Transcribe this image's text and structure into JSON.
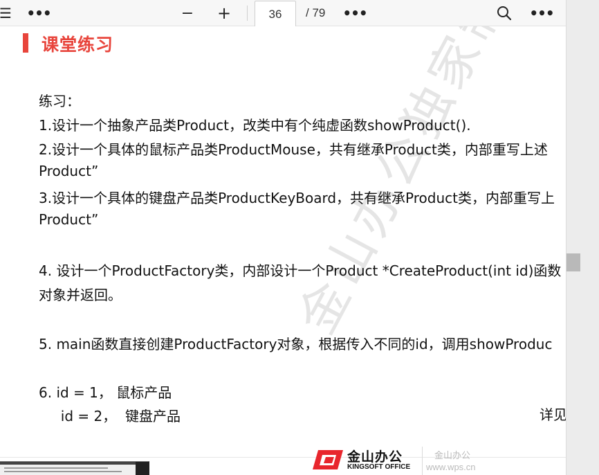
{
  "toolbar": {
    "menu_icon": "☰",
    "more_icon": "•••",
    "zoom_out_label": "−",
    "zoom_in_label": "+",
    "page_current": "36",
    "page_total": "/ 79"
  },
  "page": {
    "section_title": "课堂练习",
    "lines": [
      "练习：",
      "1.设计一个抽象产品类Product，改类中有个纯虚函数showProduct().",
      "2.设计一个具体的鼠标产品类ProductMouse，共有继承Product类，内部重写上述",
      "Product”",
      "3.设计一个具体的键盘产品类ProductKeyBoard，共有继承Product类，内部重写上",
      "Product”",
      "4. 设计一个ProductFactory类，内部设计一个Product *CreateProduct(int id)函数",
      "对象并返回。",
      "5. main函数直接创建ProductFactory对象，根据传入不同的id，调用showProduc",
      "6.  id = 1，  鼠标产品",
      "     id = 2，  键盘产品"
    ],
    "detail_text": "详见",
    "watermark": "金山办公独家制作"
  },
  "footer": {
    "brand_cn": "金山办公",
    "brand_en": "KINGSOFT OFFICE",
    "brand_cn_small": "金山办公",
    "brand_url": "www.wps.cn",
    "brand_color": "#e8262d"
  },
  "colors": {
    "accent_red": "#e8453c"
  }
}
